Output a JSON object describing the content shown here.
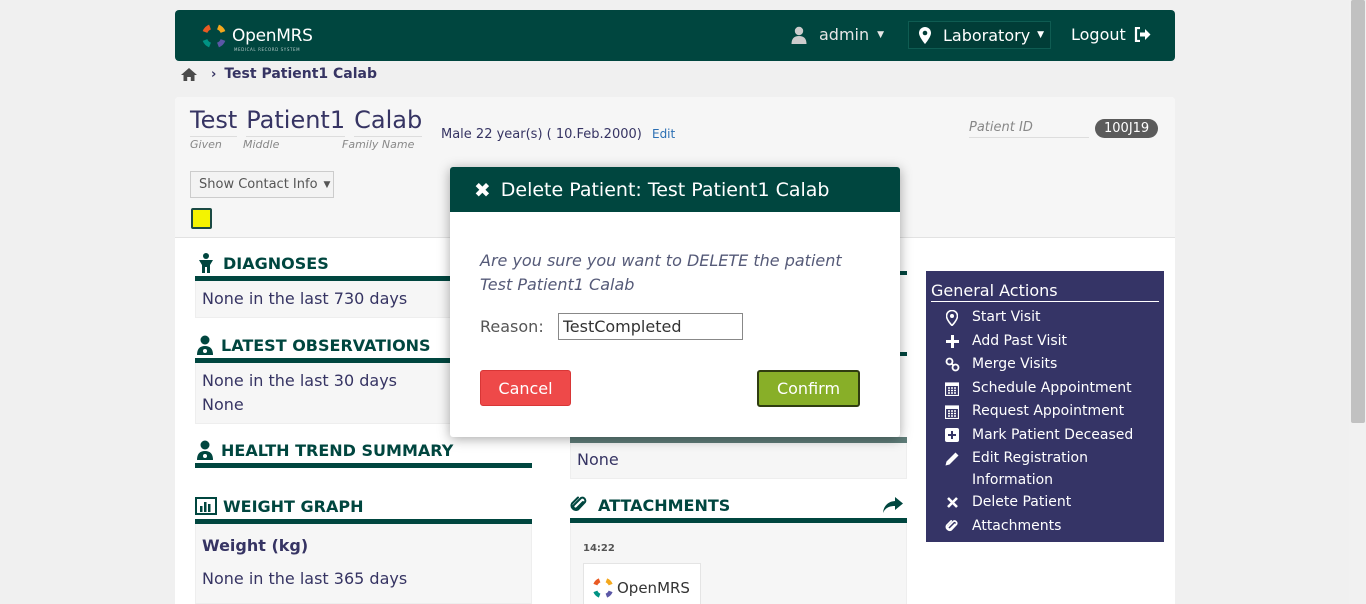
{
  "header": {
    "logo_text": "OpenMRS",
    "logo_sub": "MEDICAL RECORD SYSTEM",
    "user": "admin",
    "location": "Laboratory",
    "logout": "Logout"
  },
  "breadcrumb": {
    "current": "Test Patient1 Calab"
  },
  "patient": {
    "given": "Test",
    "middle": "Patient1",
    "family": "Calab",
    "given_label": "Given",
    "middle_label": "Middle",
    "family_label": "Family Name",
    "gender_age": "Male  22 year(s) ( 10.Feb.2000)",
    "edit": "Edit",
    "id_label": "Patient ID",
    "id": "100J19",
    "contact_btn": "Show Contact Info"
  },
  "widgets": {
    "diagnoses": {
      "title": "DIAGNOSES",
      "line1": "None in the last 730 days"
    },
    "observations": {
      "title": "LATEST OBSERVATIONS",
      "line1": "None in the last 30 days",
      "line2": "None"
    },
    "health_trend": {
      "title": "HEALTH TREND SUMMARY"
    },
    "weight": {
      "title": "WEIGHT GRAPH",
      "subtitle": "Weight (kg)",
      "line1": "None in the last 365 days"
    },
    "middle_none": "None",
    "attachments": {
      "title": "ATTACHMENTS",
      "time": "14:22",
      "thumb_text": "OpenMRS"
    }
  },
  "actions": {
    "title": "General Actions",
    "items": [
      {
        "label": "Start Visit"
      },
      {
        "label": "Add Past Visit"
      },
      {
        "label": "Merge Visits"
      },
      {
        "label": "Schedule Appointment"
      },
      {
        "label": "Request Appointment"
      },
      {
        "label": "Mark Patient Deceased"
      },
      {
        "label": "Edit Registration Information"
      },
      {
        "label": "Delete Patient"
      },
      {
        "label": "Attachments"
      }
    ]
  },
  "modal": {
    "title": "Delete Patient: Test Patient1 Calab",
    "message": "Are you sure you want to DELETE the patient Test Patient1 Calab",
    "reason_label": "Reason:",
    "reason_value": "TestCompleted",
    "cancel": "Cancel",
    "confirm": "Confirm"
  },
  "colors": {
    "brand": "#00463f",
    "sidebar": "#353466",
    "cancel": "#ee4949",
    "confirm": "#88af28"
  }
}
